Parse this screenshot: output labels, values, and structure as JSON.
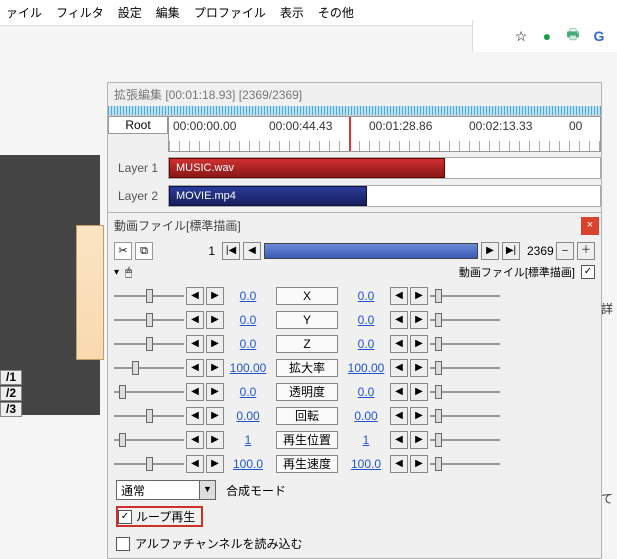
{
  "menubar": {
    "items": [
      "ァイル",
      "フィルタ",
      "設定",
      "編集",
      "プロファイル",
      "表示",
      "その他"
    ]
  },
  "chrome": {
    "star": "☆",
    "dot": "●",
    "print": "🖶",
    "g": "G"
  },
  "bg_tags": [
    "/1",
    "/2",
    "/3"
  ],
  "timeline": {
    "title": "拡張編集 [00:01:18.93] [2369/2369]",
    "root": "Root",
    "ticks": [
      "00:00:00.00",
      "00:00:44.43",
      "00:01:28.86",
      "00:02:13.33",
      "00"
    ],
    "layers": [
      {
        "label": "Layer 1",
        "clip": "MUSIC.wav",
        "cls": "clip-red"
      },
      {
        "label": "Layer 2",
        "clip": "MOVIE.mp4",
        "cls": "clip-blue"
      }
    ]
  },
  "props": {
    "title": "動画ファイル[標準描画]",
    "close": "×",
    "icons": {
      "scissors": "✂",
      "camera": "⧉",
      "eye": "▾",
      "mouse": "🖱"
    },
    "frame_cur": "1",
    "frame_total": "2369",
    "nav": {
      "first": "|◀",
      "prev": "◀",
      "next": "▶",
      "last": "▶|"
    },
    "sub_label": "動画ファイル[標準描画]",
    "plus": "＋",
    "params": [
      {
        "name": "X",
        "l": "0.0",
        "r": "0.0",
        "tl": 32,
        "tr": 5
      },
      {
        "name": "Y",
        "l": "0.0",
        "r": "0.0",
        "tl": 32,
        "tr": 5
      },
      {
        "name": "Z",
        "l": "0.0",
        "r": "0.0",
        "tl": 32,
        "tr": 5
      },
      {
        "name": "拡大率",
        "l": "100.00",
        "r": "100.00",
        "tl": 18,
        "tr": 5
      },
      {
        "name": "透明度",
        "l": "0.0",
        "r": "0.0",
        "tl": 5,
        "tr": 5
      },
      {
        "name": "回転",
        "l": "0.00",
        "r": "0.00",
        "tl": 32,
        "tr": 5
      },
      {
        "name": "再生位置",
        "l": "1",
        "r": "1",
        "tl": 5,
        "tr": 5
      },
      {
        "name": "再生速度",
        "l": "100.0",
        "r": "100.0",
        "tl": 32,
        "tr": 5
      }
    ],
    "combo": "通常",
    "mode_label": "合成モード",
    "opt_loop": "ループ再生",
    "opt_alpha": "アルファチャンネルを読み込む"
  },
  "side": {
    "a": "詳",
    "b": "て"
  }
}
